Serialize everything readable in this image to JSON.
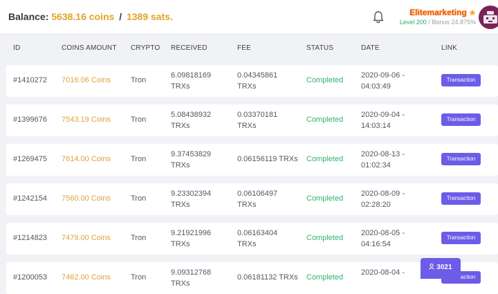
{
  "header": {
    "balance_label": "Balance:",
    "balance_coins": "5638.16 coins",
    "balance_sep": "/",
    "balance_sats": "1389 sats.",
    "username": "Elitemarketing",
    "level_prefix": "Level 200",
    "level_suffix": " / Bonus 24.875%"
  },
  "columns": [
    "ID",
    "COINS AMOUNT",
    "CRYPTO",
    "RECEIVED",
    "FEE",
    "STATUS",
    "DATE",
    "LINK"
  ],
  "rows": [
    {
      "id": "#1410272",
      "coins": "7016.06 Coins",
      "crypto": "Tron",
      "received1": "6.09818169",
      "received2": "TRXs",
      "fee1": "0.04345861",
      "fee2": "TRXs",
      "status": "Completed",
      "date1": "2020-09-06 -",
      "date2": "04:03:49",
      "link": "Transaction"
    },
    {
      "id": "#1399676",
      "coins": "7543.19 Coins",
      "crypto": "Tron",
      "received1": "5.08438932",
      "received2": "TRXs",
      "fee1": "0.03370181",
      "fee2": "TRXs",
      "status": "Completed",
      "date1": "2020-09-04 -",
      "date2": "14:03:14",
      "link": "Transaction"
    },
    {
      "id": "#1269475",
      "coins": "7614.00 Coins",
      "crypto": "Tron",
      "received1": "9.37453829",
      "received2": "TRXs",
      "fee1": "0.06156119 TRXs",
      "fee2": "",
      "status": "Completed",
      "date1": "2020-08-13 -",
      "date2": "01:02:34",
      "link": "Transaction"
    },
    {
      "id": "#1242154",
      "coins": "7560.00 Coins",
      "crypto": "Tron",
      "received1": "9.23302394",
      "received2": "TRXs",
      "fee1": "0.06106497",
      "fee2": "TRXs",
      "status": "Completed",
      "date1": "2020-08-09 -",
      "date2": "02:28:20",
      "link": "Transaction"
    },
    {
      "id": "#1214823",
      "coins": "7479.00 Coins",
      "crypto": "Tron",
      "received1": "9.21921996",
      "received2": "TRXs",
      "fee1": "0.06163404",
      "fee2": "TRXs",
      "status": "Completed",
      "date1": "2020-08-05 -",
      "date2": "04:16:54",
      "link": "Transaction"
    },
    {
      "id": "#1200053",
      "coins": "7462.00 Coins",
      "crypto": "Tron",
      "received1": "9.09312768",
      "received2": "TRXs",
      "fee1": "0.06181132 TRXs",
      "fee2": "",
      "status": "Completed",
      "date1": "2020-08-04 -",
      "date2": "",
      "link": "Transaction"
    }
  ],
  "online_count": "3021",
  "colors": {
    "accent": "#6c5ce7",
    "coins": "#e0a526",
    "status_completed": "#33b26b",
    "username": "#e8542c"
  },
  "icons": {
    "bell": "bell-icon",
    "user": "user-icon",
    "star": "star-icon"
  }
}
